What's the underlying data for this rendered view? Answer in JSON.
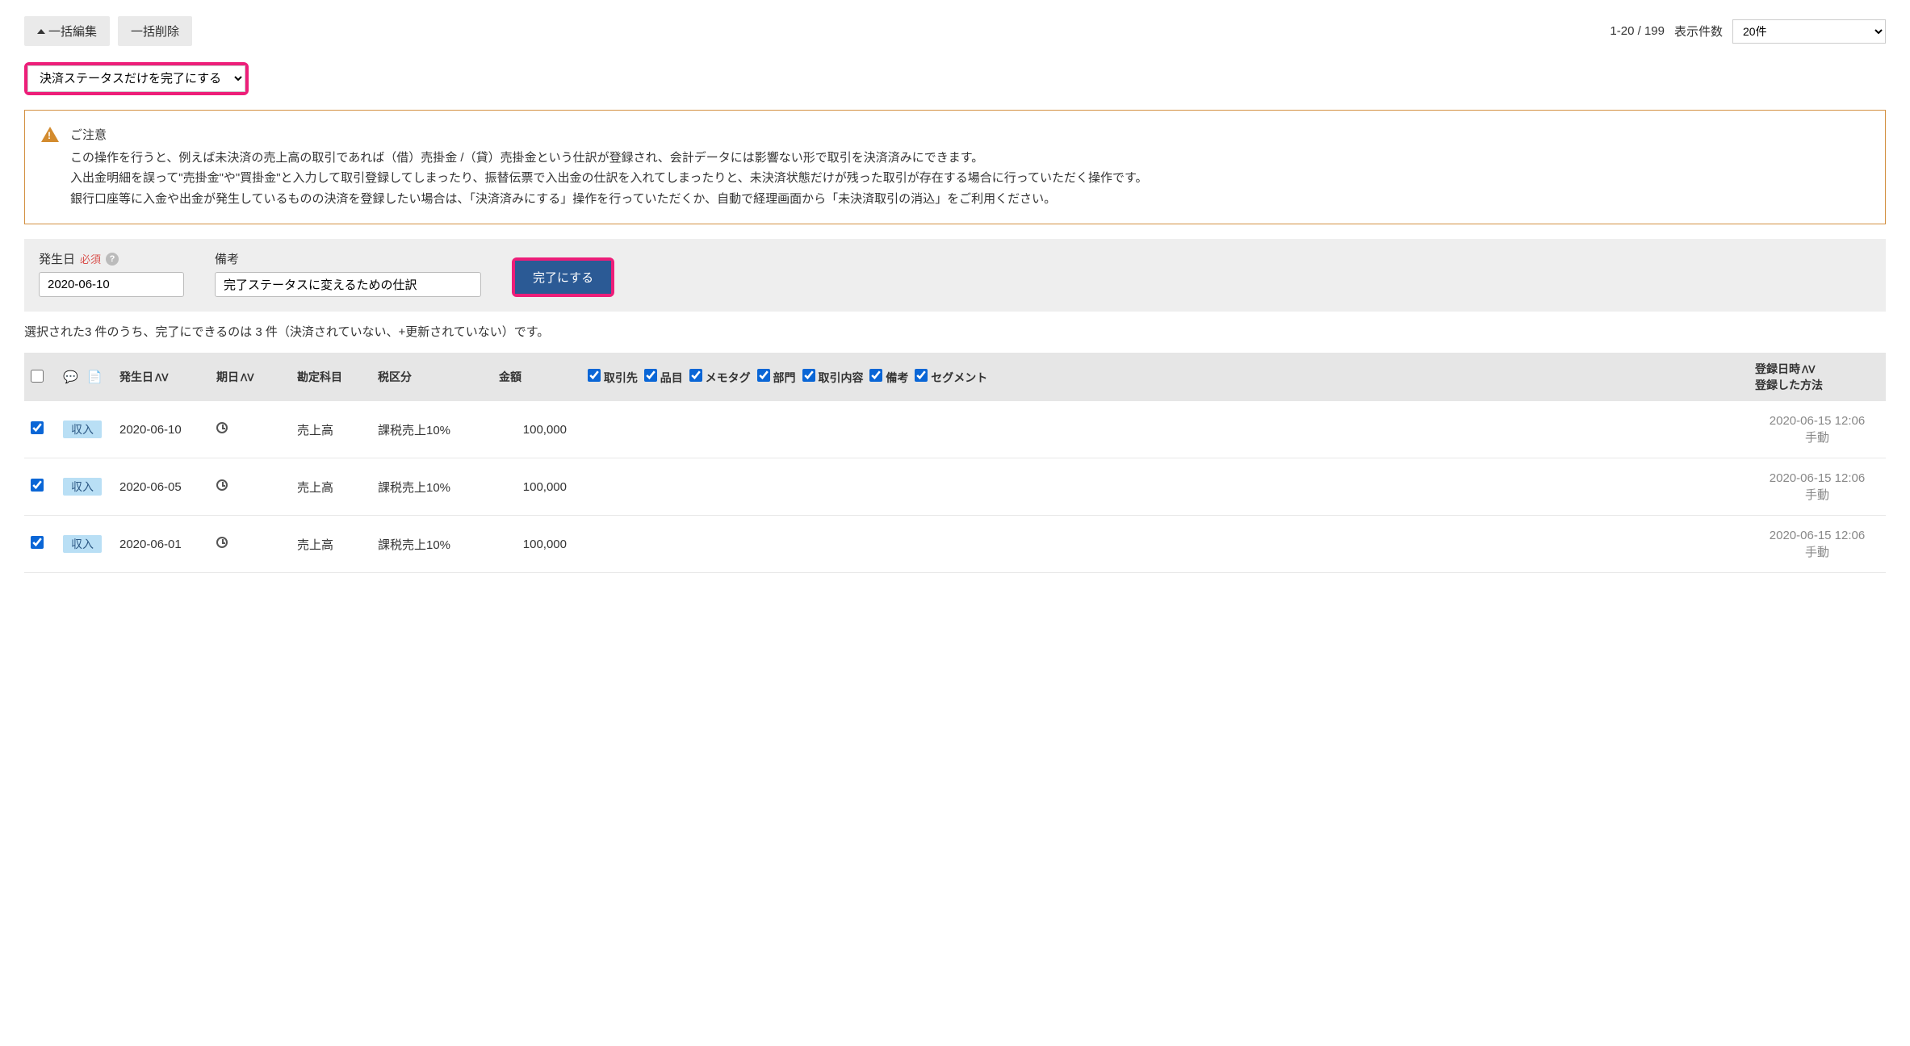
{
  "topButtons": {
    "bulkEdit": "一括編集",
    "bulkDelete": "一括削除"
  },
  "pagination": {
    "range": "1-20 / 199",
    "perPageLabel": "表示件数",
    "perPageValue": "20件"
  },
  "actionSelect": "決済ステータスだけを完了にする",
  "warning": {
    "title": "ご注意",
    "p1": "この操作を行うと、例えば未決済の売上高の取引であれば（借）売掛金 /（貸）売掛金という仕訳が登録され、会計データには影響ない形で取引を決済済みにできます。",
    "p2": "入出金明細を誤って\"売掛金\"や\"買掛金\"と入力して取引登録してしまったり、振替伝票で入出金の仕訳を入れてしまったりと、未決済状態だけが残った取引が存在する場合に行っていただく操作です。",
    "p3": "銀行口座等に入金や出金が発生しているものの決済を登録したい場合は、「決済済みにする」操作を行っていただくか、自動で経理画面から「未決済取引の消込」をご利用ください。"
  },
  "form": {
    "dateLabel": "発生日",
    "required": "必須",
    "dateValue": "2020-06-10",
    "remarkLabel": "備考",
    "remarkValue": "完了ステータスに変えるための仕訳",
    "submitLabel": "完了にする"
  },
  "selectionNote": "選択された3 件のうち、完了にできるのは 3 件（決済されていない、+更新されていない）です。",
  "columns": {
    "date": "発生日",
    "dueDate": "期日",
    "account": "勘定科目",
    "tax": "税区分",
    "amount": "金額",
    "regDate": "登録日時",
    "regMethod": "登録した方法"
  },
  "tagCheckboxes": [
    "取引先",
    "品目",
    "メモタグ",
    "部門",
    "取引内容",
    "備考",
    "セグメント"
  ],
  "rows": [
    {
      "checked": true,
      "type": "収入",
      "date": "2020-06-10",
      "account": "売上高",
      "tax": "課税売上10%",
      "amount": "100,000",
      "regDate": "2020-06-15 12:06",
      "regMethod": "手動"
    },
    {
      "checked": true,
      "type": "収入",
      "date": "2020-06-05",
      "account": "売上高",
      "tax": "課税売上10%",
      "amount": "100,000",
      "regDate": "2020-06-15 12:06",
      "regMethod": "手動"
    },
    {
      "checked": true,
      "type": "収入",
      "date": "2020-06-01",
      "account": "売上高",
      "tax": "課税売上10%",
      "amount": "100,000",
      "regDate": "2020-06-15 12:06",
      "regMethod": "手動"
    }
  ]
}
